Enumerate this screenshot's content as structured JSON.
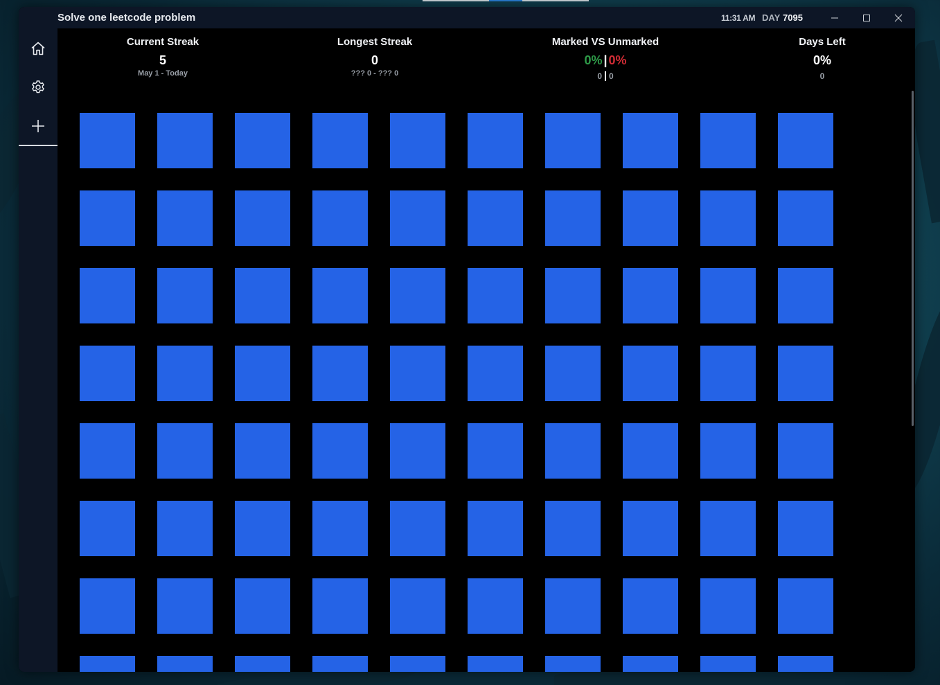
{
  "window": {
    "title": "Solve one leetcode problem",
    "time": "11:31 AM",
    "day_label": "DAY",
    "day_value": "7095"
  },
  "window_controls": [
    "minimize-icon",
    "maximize-icon",
    "close-icon"
  ],
  "sidebar": {
    "items": [
      {
        "name": "home",
        "icon": "home-icon"
      },
      {
        "name": "settings",
        "icon": "gear-icon"
      },
      {
        "name": "add",
        "icon": "plus-icon"
      }
    ]
  },
  "stats": {
    "current_streak": {
      "title": "Current Streak",
      "value": "5",
      "range": "May 1 - Today"
    },
    "longest_streak": {
      "title": "Longest Streak",
      "value": "0",
      "range": "??? 0 - ??? 0"
    },
    "marked_vs_unmarked": {
      "title": "Marked VS Unmarked",
      "marked_pct": "0%",
      "separator": "|",
      "unmarked_pct": "0%",
      "marked_count": "0",
      "unmarked_count": "0"
    },
    "days_left": {
      "title": "Days Left",
      "value": "0%",
      "count": "0"
    }
  },
  "grid": {
    "columns": 10,
    "visible_rows": 8,
    "cell_color": "#2563e6"
  },
  "colors": {
    "accent_blue": "#2563e6",
    "marked_green": "#2e9a48",
    "unmarked_red": "#d12c35",
    "chrome": "#0d1626"
  }
}
